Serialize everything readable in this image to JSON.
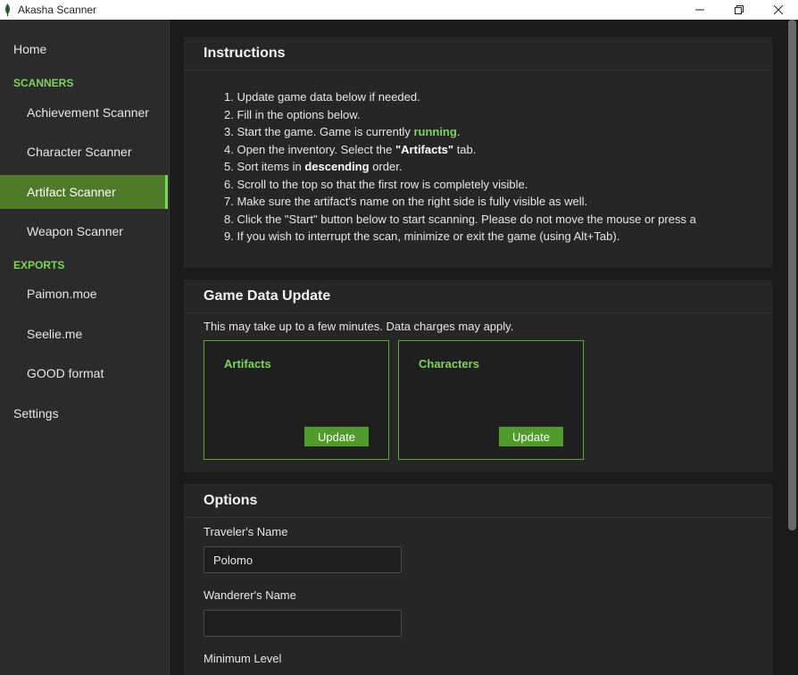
{
  "window": {
    "title": "Akasha Scanner",
    "icon": "leaf-icon"
  },
  "sidebar": {
    "home": "Home",
    "scanners_heading": "SCANNERS",
    "scanners": [
      "Achievement Scanner",
      "Character Scanner",
      "Artifact Scanner",
      "Weapon Scanner"
    ],
    "active_item": "Artifact Scanner",
    "exports_heading": "EXPORTS",
    "exports": [
      "Paimon.moe",
      "Seelie.me",
      "GOOD format"
    ],
    "settings": "Settings"
  },
  "instructions": {
    "title": "Instructions",
    "steps": [
      {
        "num": "1.",
        "text": "Update game data below if needed."
      },
      {
        "num": "2.",
        "text": "Fill in the options below."
      },
      {
        "num": "3.",
        "pre": "Start the game. Game is currently ",
        "highlight": "running",
        "post": "."
      },
      {
        "num": "4.",
        "pre": "Open the inventory. Select the ",
        "bold": "\"Artifacts\"",
        "post": " tab."
      },
      {
        "num": "5.",
        "pre": "Sort items in ",
        "bold": "descending",
        "post": " order."
      },
      {
        "num": "6.",
        "text": "Scroll to the top so that the first row is completely visible."
      },
      {
        "num": "7.",
        "text": "Make sure the artifact's name on the right side is fully visible as well."
      },
      {
        "num": "8.",
        "text": "Click the \"Start\" button below to start scanning. Please do not move the mouse or press a"
      },
      {
        "num": "9.",
        "text": "If you wish to interrupt the scan, minimize or exit the game (using Alt+Tab)."
      }
    ]
  },
  "game_data_update": {
    "title": "Game Data Update",
    "note": "This may take up to a few minutes. Data charges may apply.",
    "boxes": [
      {
        "label": "Artifacts",
        "button": "Update"
      },
      {
        "label": "Characters",
        "button": "Update"
      }
    ]
  },
  "options": {
    "title": "Options",
    "travelers_name_label": "Traveler's Name",
    "travelers_name_value": "Polomo",
    "wanderers_name_label": "Wanderer's Name",
    "wanderers_name_value": "",
    "minimum_level_label": "Minimum Level"
  },
  "colors": {
    "accent": "#7fd35a",
    "button": "#4f9b2b",
    "active_nav": "#4e7a29",
    "background": "#1b1b1b",
    "card": "#262626",
    "sidebar": "#2b2b2b"
  }
}
